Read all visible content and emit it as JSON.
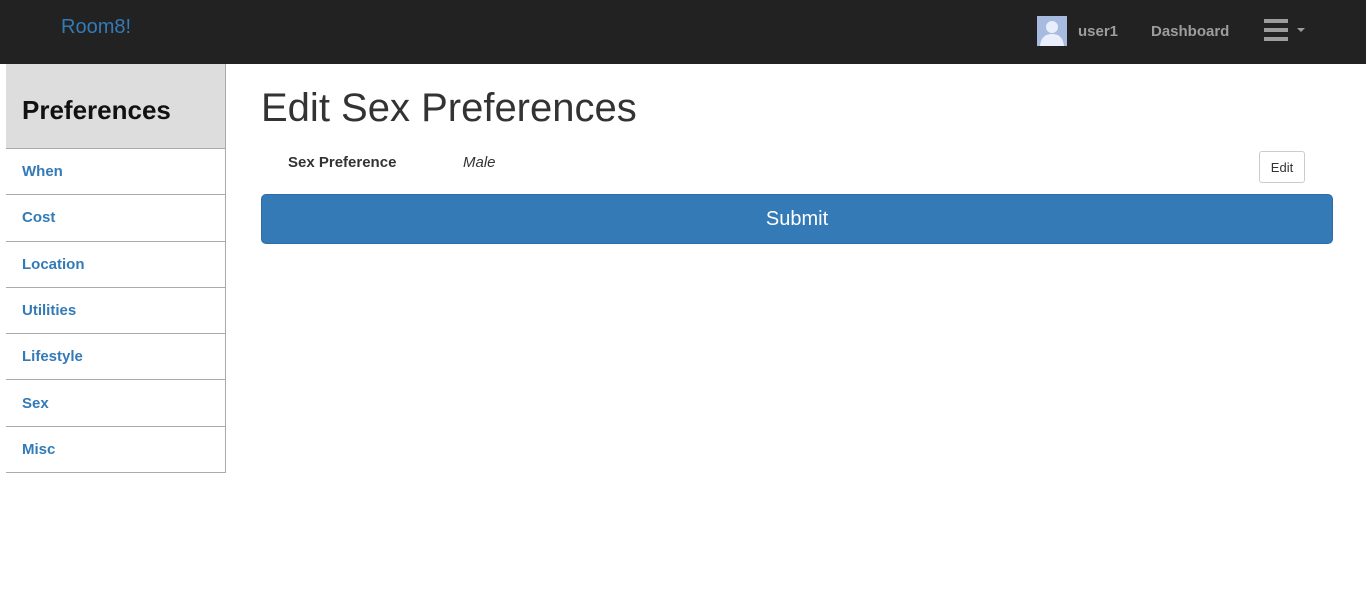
{
  "navbar": {
    "brand": "Room8!",
    "username": "user1",
    "dashboard_label": "Dashboard"
  },
  "sidebar": {
    "title": "Preferences",
    "items": [
      {
        "label": "When"
      },
      {
        "label": "Cost"
      },
      {
        "label": "Location"
      },
      {
        "label": "Utilities"
      },
      {
        "label": "Lifestyle"
      },
      {
        "label": "Sex"
      },
      {
        "label": "Misc"
      }
    ]
  },
  "main": {
    "title": "Edit Sex Preferences",
    "preference_label": "Sex Preference",
    "preference_value": "Male",
    "edit_label": "Edit",
    "submit_label": "Submit"
  },
  "colors": {
    "navbar_bg": "#222222",
    "link": "#337ab7",
    "primary": "#337ab7",
    "sidebar_header_bg": "#dddddd"
  },
  "icons": [
    "user-avatar-icon",
    "hamburger-menu-icon",
    "caret-down-icon"
  ]
}
